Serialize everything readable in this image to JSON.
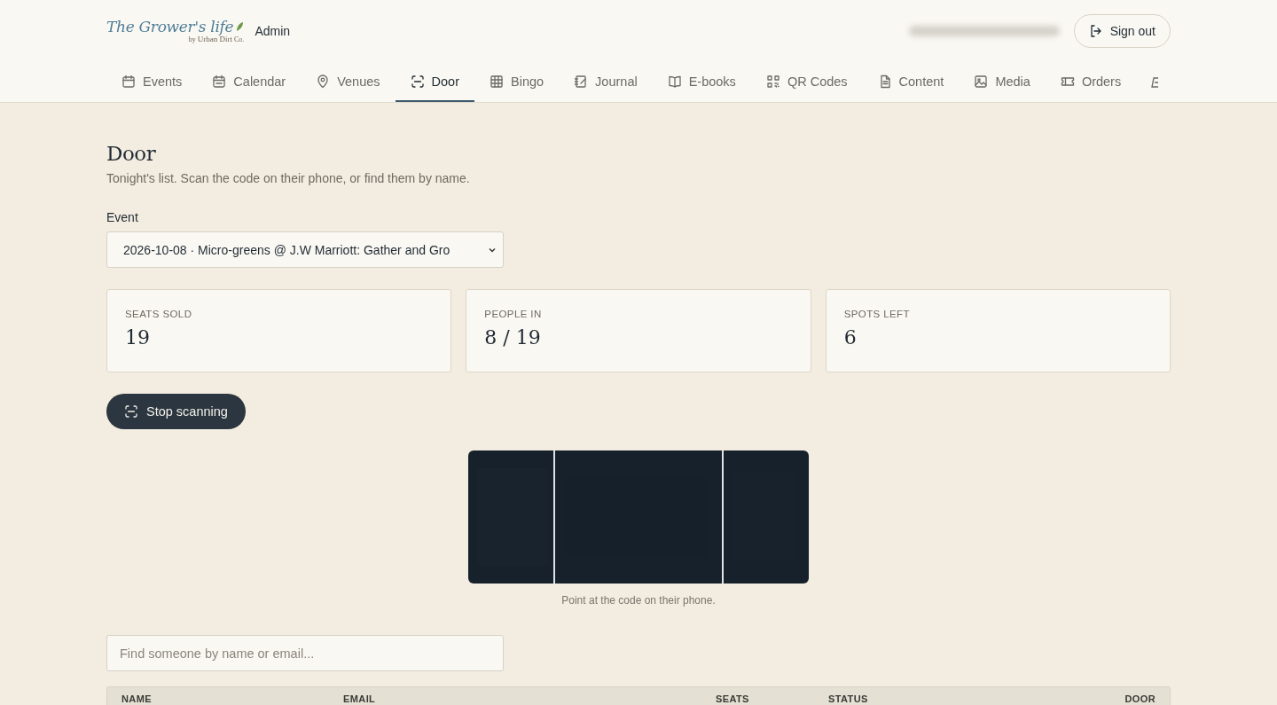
{
  "brand": {
    "logo": "The Grower's life",
    "by": "by",
    "sub": "Urban Dirt",
    "co": "Co.",
    "section": "Admin"
  },
  "account": {
    "sign_out": "Sign out"
  },
  "tabs": [
    {
      "label": "Events",
      "selected": false
    },
    {
      "label": "Calendar",
      "selected": false
    },
    {
      "label": "Venues",
      "selected": false
    },
    {
      "label": "Door",
      "selected": true
    },
    {
      "label": "Bingo",
      "selected": false
    },
    {
      "label": "Journal",
      "selected": false
    },
    {
      "label": "E-books",
      "selected": false
    },
    {
      "label": "QR Codes",
      "selected": false
    },
    {
      "label": "Content",
      "selected": false
    },
    {
      "label": "Media",
      "selected": false
    },
    {
      "label": "Orders",
      "selected": false
    }
  ],
  "page": {
    "title": "Door",
    "subtitle": "Tonight's list. Scan the code on their phone, or find them by name."
  },
  "event": {
    "label": "Event",
    "value": "2026-10-08 · Micro-greens @ J.W Marriott: Gather and Gro"
  },
  "stats": [
    {
      "label": "SEATS SOLD",
      "value": "19"
    },
    {
      "label": "PEOPLE IN",
      "value": "8 / 19"
    },
    {
      "label": "SPOTS LEFT",
      "value": "6"
    }
  ],
  "scanner": {
    "button": "Stop scanning",
    "hint": "Point at the code on their phone."
  },
  "search": {
    "placeholder": "Find someone by name or email..."
  },
  "table": {
    "columns": [
      "NAME",
      "EMAIL",
      "SEATS",
      "STATUS",
      "DOOR"
    ]
  }
}
